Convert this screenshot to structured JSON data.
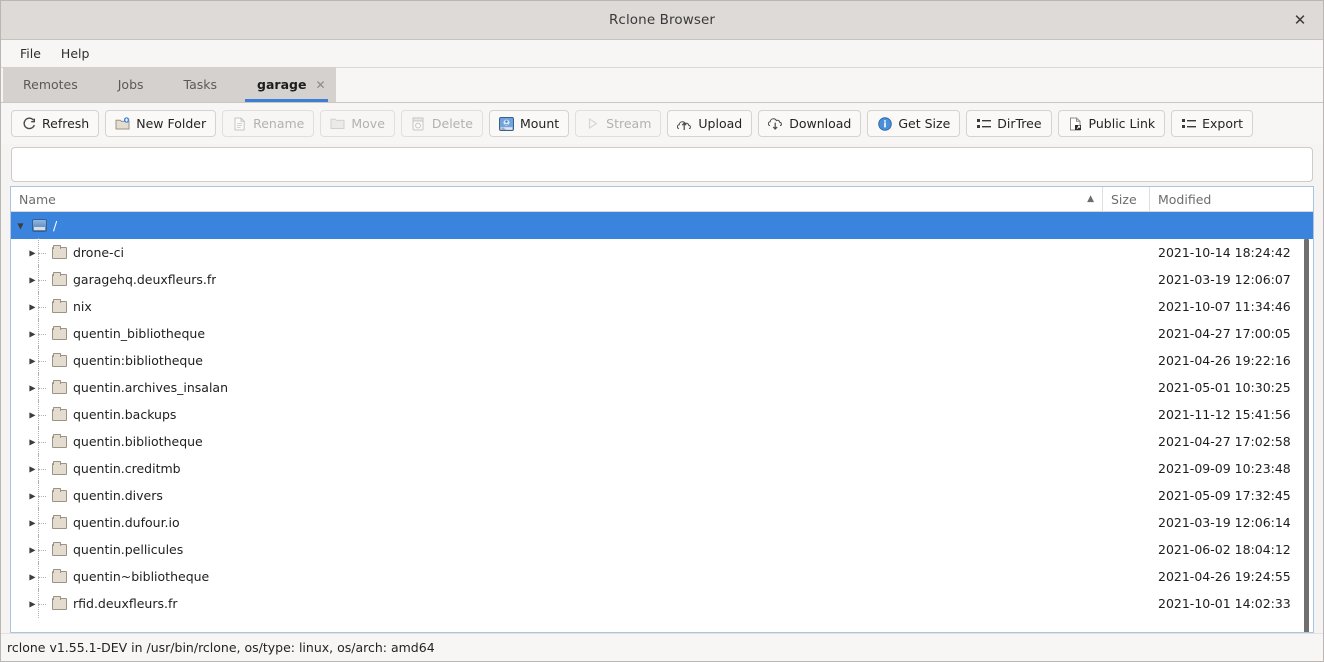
{
  "window": {
    "title": "Rclone Browser",
    "close_label": "✕"
  },
  "menubar": {
    "items": [
      {
        "label": "File",
        "name": "menu-file"
      },
      {
        "label": "Help",
        "name": "menu-help"
      }
    ]
  },
  "tabs": {
    "items": [
      {
        "label": "Remotes",
        "active": false,
        "closable": false
      },
      {
        "label": "Jobs",
        "active": false,
        "closable": false
      },
      {
        "label": "Tasks",
        "active": false,
        "closable": false
      },
      {
        "label": "garage",
        "active": true,
        "closable": true
      }
    ],
    "close_glyph": "✕"
  },
  "toolbar": {
    "buttons": [
      {
        "label": "Refresh",
        "icon": "refresh-icon",
        "enabled": true
      },
      {
        "label": "New Folder",
        "icon": "new-folder-icon",
        "enabled": true
      },
      {
        "label": "Rename",
        "icon": "rename-icon",
        "enabled": false
      },
      {
        "label": "Move",
        "icon": "move-icon",
        "enabled": false
      },
      {
        "label": "Delete",
        "icon": "delete-icon",
        "enabled": false
      },
      {
        "label": "Mount",
        "icon": "mount-icon",
        "enabled": true
      },
      {
        "label": "Stream",
        "icon": "stream-icon",
        "enabled": false
      },
      {
        "label": "Upload",
        "icon": "upload-icon",
        "enabled": true
      },
      {
        "label": "Download",
        "icon": "download-icon",
        "enabled": true
      },
      {
        "label": "Get Size",
        "icon": "info-icon",
        "enabled": true
      },
      {
        "label": "DirTree",
        "icon": "list-icon",
        "enabled": true
      },
      {
        "label": "Public Link",
        "icon": "public-link-icon",
        "enabled": true
      },
      {
        "label": "Export",
        "icon": "list-icon",
        "enabled": true
      }
    ]
  },
  "filter": {
    "value": "",
    "placeholder": ""
  },
  "tree": {
    "columns": [
      {
        "label": "Name",
        "sorted": true,
        "sort_glyph": "▲"
      },
      {
        "label": "Size",
        "sorted": false,
        "sort_glyph": ""
      },
      {
        "label": "Modified",
        "sorted": false,
        "sort_glyph": ""
      }
    ],
    "expand_collapsed_glyph": "▶",
    "expand_expanded_glyph": "▼",
    "rows": [
      {
        "name": "/",
        "size": "",
        "modified": "",
        "icon": "drive-icon",
        "depth": 0,
        "expanded": true,
        "selected": true
      },
      {
        "name": "drone-ci",
        "size": "",
        "modified": "2021-10-14 18:24:42",
        "icon": "folder-icon",
        "depth": 1,
        "expanded": false,
        "selected": false
      },
      {
        "name": "garagehq.deuxfleurs.fr",
        "size": "",
        "modified": "2021-03-19 12:06:07",
        "icon": "folder-icon",
        "depth": 1,
        "expanded": false,
        "selected": false
      },
      {
        "name": "nix",
        "size": "",
        "modified": "2021-10-07 11:34:46",
        "icon": "folder-icon",
        "depth": 1,
        "expanded": false,
        "selected": false
      },
      {
        "name": "quentin_bibliotheque",
        "size": "",
        "modified": "2021-04-27 17:00:05",
        "icon": "folder-icon",
        "depth": 1,
        "expanded": false,
        "selected": false
      },
      {
        "name": "quentin:bibliotheque",
        "size": "",
        "modified": "2021-04-26 19:22:16",
        "icon": "folder-icon",
        "depth": 1,
        "expanded": false,
        "selected": false
      },
      {
        "name": "quentin.archives_insalan",
        "size": "",
        "modified": "2021-05-01 10:30:25",
        "icon": "folder-icon",
        "depth": 1,
        "expanded": false,
        "selected": false
      },
      {
        "name": "quentin.backups",
        "size": "",
        "modified": "2021-11-12 15:41:56",
        "icon": "folder-icon",
        "depth": 1,
        "expanded": false,
        "selected": false
      },
      {
        "name": "quentin.bibliotheque",
        "size": "",
        "modified": "2021-04-27 17:02:58",
        "icon": "folder-icon",
        "depth": 1,
        "expanded": false,
        "selected": false
      },
      {
        "name": "quentin.creditmb",
        "size": "",
        "modified": "2021-09-09 10:23:48",
        "icon": "folder-icon",
        "depth": 1,
        "expanded": false,
        "selected": false
      },
      {
        "name": "quentin.divers",
        "size": "",
        "modified": "2021-05-09 17:32:45",
        "icon": "folder-icon",
        "depth": 1,
        "expanded": false,
        "selected": false
      },
      {
        "name": "quentin.dufour.io",
        "size": "",
        "modified": "2021-03-19 12:06:14",
        "icon": "folder-icon",
        "depth": 1,
        "expanded": false,
        "selected": false
      },
      {
        "name": "quentin.pellicules",
        "size": "",
        "modified": "2021-06-02 18:04:12",
        "icon": "folder-icon",
        "depth": 1,
        "expanded": false,
        "selected": false
      },
      {
        "name": "quentin~bibliotheque",
        "size": "",
        "modified": "2021-04-26 19:24:55",
        "icon": "folder-icon",
        "depth": 1,
        "expanded": false,
        "selected": false
      },
      {
        "name": "rfid.deuxfleurs.fr",
        "size": "",
        "modified": "2021-10-01 14:02:33",
        "icon": "folder-icon",
        "depth": 1,
        "expanded": false,
        "selected": false
      }
    ]
  },
  "statusbar": {
    "text": "rclone v1.55.1-DEV in /usr/bin/rclone, os/type: linux, os/arch: amd64"
  },
  "colors": {
    "selection": "#3b84dd",
    "tab_accent": "#3b7fd4",
    "titlebar": "#dedad8",
    "window_bg": "#f7f6f5"
  }
}
